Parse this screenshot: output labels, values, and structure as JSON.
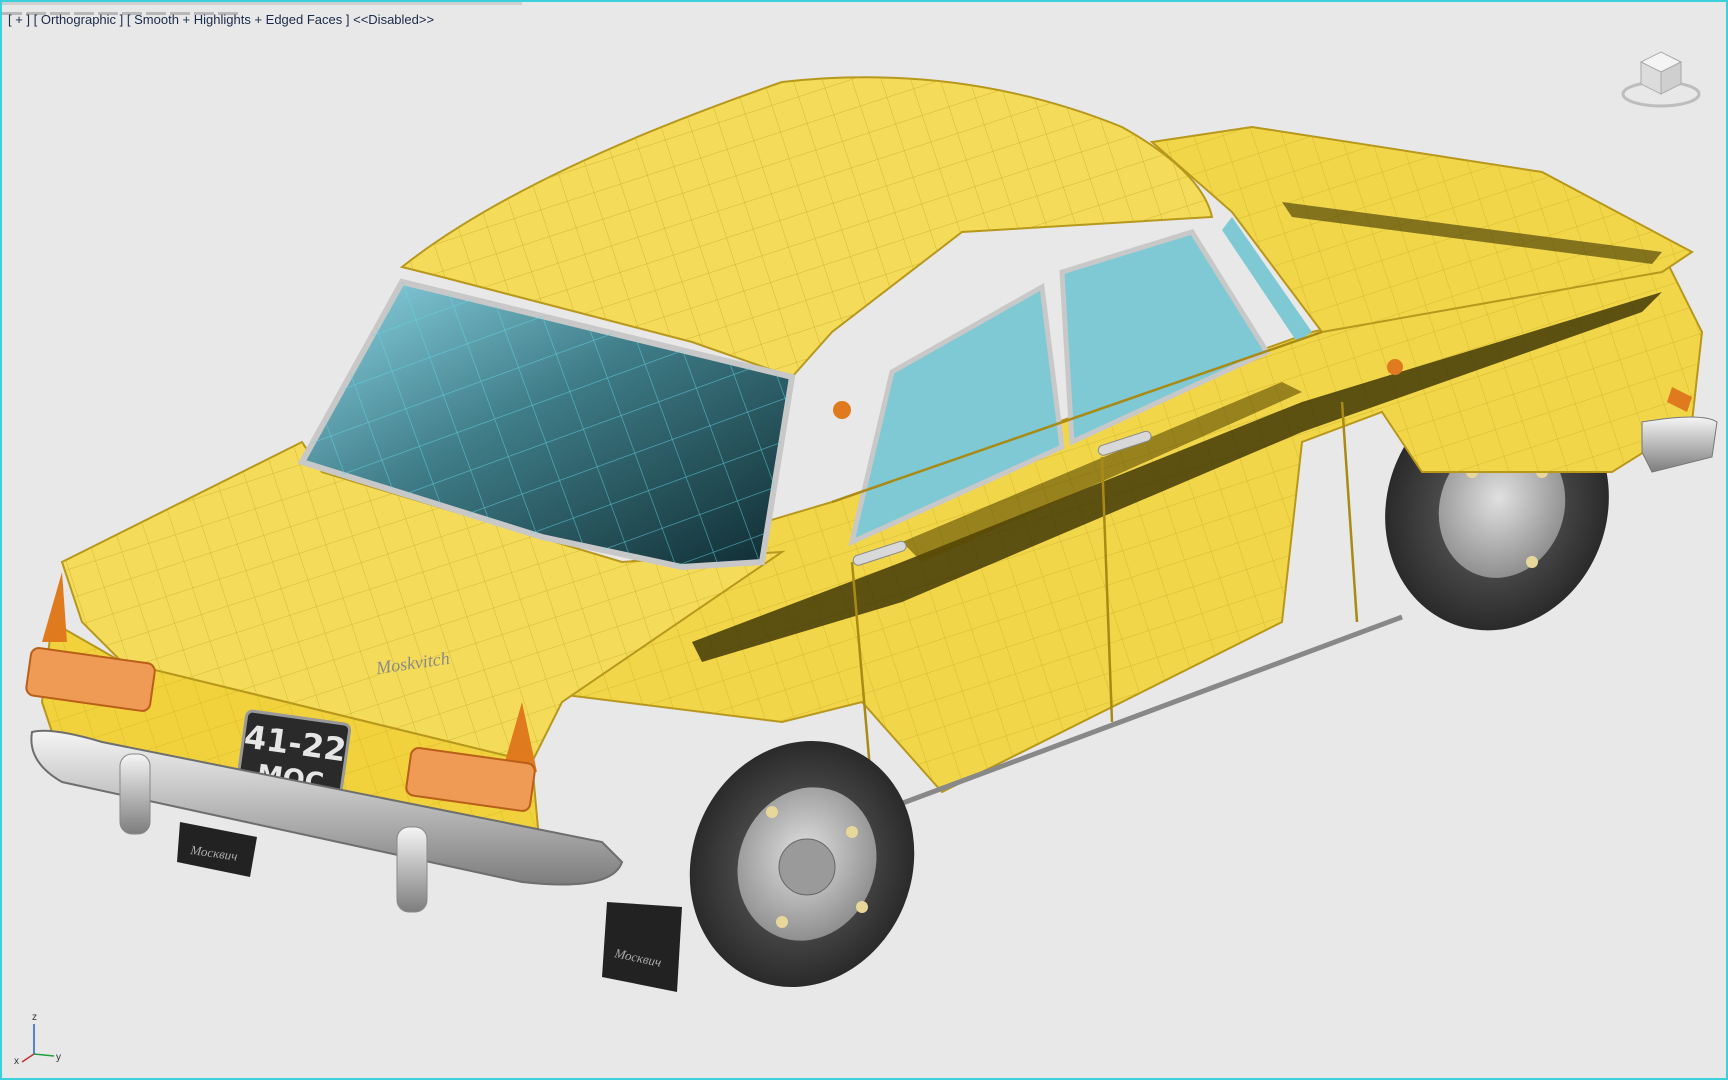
{
  "viewport": {
    "label_plus": "[ + ]",
    "label_view": "[ Orthographic ]",
    "label_shading": "[ Smooth + Highlights + Edged Faces ]",
    "label_status": "<<Disabled>>"
  },
  "viewcube": {
    "icon": "viewcube-icon"
  },
  "model": {
    "plate_line1": "41-22",
    "plate_line2": "MOC",
    "badge": "Moskvitch",
    "mudflap_text": "Москвич",
    "body_color": "#f2d64a",
    "glass_color": "#7ec9d4",
    "tire_color": "#3a3a3a"
  },
  "axis_gizmo": {
    "z": "z",
    "x": "x",
    "y": "y"
  }
}
